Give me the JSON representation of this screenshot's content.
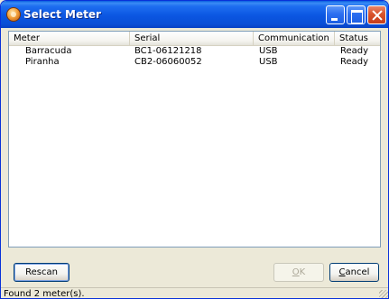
{
  "window": {
    "title": "Select Meter"
  },
  "titlebar_icons": {
    "app": "meter-app-icon",
    "minimize": "minimize-icon",
    "maximize": "maximize-icon",
    "close": "close-icon"
  },
  "table": {
    "columns": [
      "Meter",
      "Serial",
      "Communication",
      "Status"
    ],
    "rows": [
      {
        "meter": "Barracuda",
        "serial": "BC1-06121218",
        "communication": "USB",
        "status": "Ready"
      },
      {
        "meter": "Piranha",
        "serial": "CB2-06060052",
        "communication": "USB",
        "status": "Ready"
      }
    ]
  },
  "buttons": {
    "rescan": "Rescan",
    "ok": {
      "mnemonic": "O",
      "rest": "K"
    },
    "cancel": {
      "mnemonic": "C",
      "rest": "ancel"
    }
  },
  "statusbar": {
    "text": "Found 2 meter(s)."
  },
  "colors": {
    "titlebar": "#0b56e2",
    "window_bg": "#ece9d8",
    "list_border": "#7f9db9"
  }
}
